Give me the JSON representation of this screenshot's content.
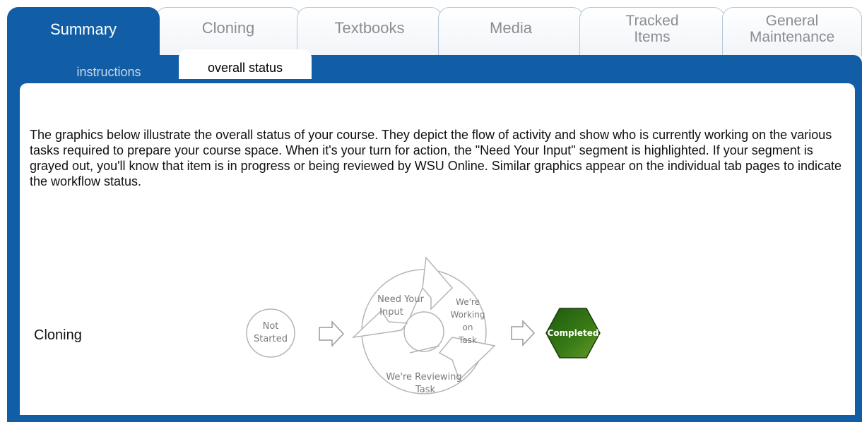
{
  "tabs": [
    {
      "label": "Summary",
      "active": true
    },
    {
      "label": "Cloning",
      "active": false
    },
    {
      "label": "Textbooks",
      "active": false
    },
    {
      "label": "Media",
      "active": false
    },
    {
      "label_line1": "Tracked",
      "label_line2": "Items",
      "active": false
    },
    {
      "label_line1": "General",
      "label_line2": "Maintenance",
      "active": false
    }
  ],
  "subtabs": [
    {
      "label": "instructions",
      "active": false
    },
    {
      "label": "overall status",
      "active": true
    }
  ],
  "content": {
    "intro": "The graphics below illustrate the overall status of your course. They depict the flow of activity and show who is currently working on the various tasks required to prepare your course space. When it's your turn for action, the \"Need Your Input\" segment is highlighted. If your segment is grayed out, you'll know that item is in progress or being reviewed by WSU Online. Similar graphics appear on the individual tab pages to indicate the workflow status."
  },
  "workflow": {
    "row_label": "Cloning",
    "not_started_line1": "Not",
    "not_started_line2": "Started",
    "need_input_line1": "Need Your",
    "need_input_line2": "Input",
    "working_line1": "We're",
    "working_line2": "Working",
    "working_line3": "on",
    "working_line4": "Task",
    "reviewing_line1": "We're Reviewing",
    "reviewing_line2": "Task",
    "completed": "Completed",
    "colors": {
      "tab_active": "#115ea6",
      "completed_fill": "#2e6b12",
      "diagram_stroke": "#b5b5b5",
      "diagram_text": "#7a7a7a"
    }
  }
}
